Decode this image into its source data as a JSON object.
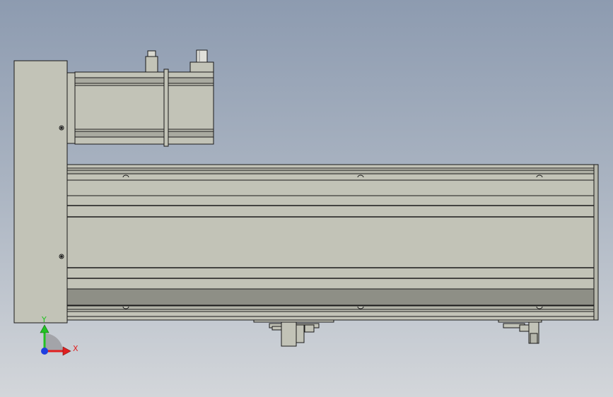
{
  "viewport": {
    "background_top": "#8d9bb0",
    "background_bottom": "#d3d6da"
  },
  "model": {
    "body_color": "#c2c3b7",
    "shade_color": "#a3a49a",
    "dark_band_color": "#8e8f86",
    "edge_color": "#1a1a1a"
  },
  "triad": {
    "y_label": "Y",
    "x_label": "X",
    "y_color": "#22c222",
    "x_color": "#e02020",
    "z_color": "#1f3fe0",
    "icon": "coordinate-triad-icon"
  }
}
